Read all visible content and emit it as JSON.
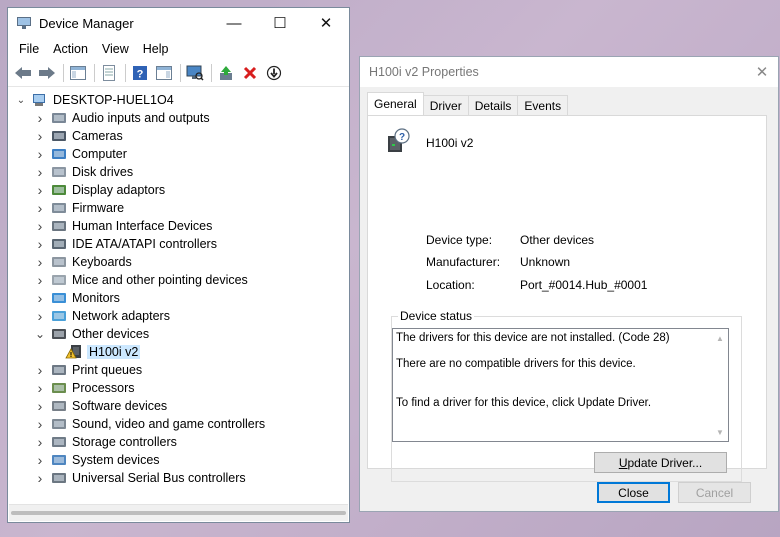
{
  "device_manager": {
    "title": "Device Manager",
    "window_controls": {
      "minimize": "—",
      "maximize": "☐",
      "close": "✕"
    },
    "menu": [
      "File",
      "Action",
      "View",
      "Help"
    ],
    "toolbar_icons": [
      "back-arrow-icon",
      "forward-arrow-icon",
      "show-hide-console-tree-icon",
      "properties-icon",
      "help-icon",
      "action-pane-icon",
      "scan-hardware-icon",
      "update-driver-icon",
      "uninstall-device-icon",
      "disable-device-icon"
    ],
    "tree": {
      "root": "DESKTOP-HUEL1O4",
      "categories": [
        {
          "label": "Audio inputs and outputs",
          "icon": "speaker-icon",
          "expanded": false
        },
        {
          "label": "Cameras",
          "icon": "camera-icon",
          "expanded": false
        },
        {
          "label": "Computer",
          "icon": "computer-icon",
          "expanded": false
        },
        {
          "label": "Disk drives",
          "icon": "disk-drive-icon",
          "expanded": false
        },
        {
          "label": "Display adaptors",
          "icon": "display-adapter-icon",
          "expanded": false
        },
        {
          "label": "Firmware",
          "icon": "firmware-icon",
          "expanded": false
        },
        {
          "label": "Human Interface Devices",
          "icon": "hid-icon",
          "expanded": false
        },
        {
          "label": "IDE ATA/ATAPI controllers",
          "icon": "ide-controller-icon",
          "expanded": false
        },
        {
          "label": "Keyboards",
          "icon": "keyboard-icon",
          "expanded": false
        },
        {
          "label": "Mice and other pointing devices",
          "icon": "mouse-icon",
          "expanded": false
        },
        {
          "label": "Monitors",
          "icon": "monitor-icon",
          "expanded": false
        },
        {
          "label": "Network adapters",
          "icon": "network-adapter-icon",
          "expanded": false
        },
        {
          "label": "Other devices",
          "icon": "unknown-device-icon",
          "expanded": true,
          "children": [
            "H100i v2"
          ]
        },
        {
          "label": "Print queues",
          "icon": "printer-icon",
          "expanded": false
        },
        {
          "label": "Processors",
          "icon": "processor-icon",
          "expanded": false
        },
        {
          "label": "Software devices",
          "icon": "software-device-icon",
          "expanded": false
        },
        {
          "label": "Sound, video and game controllers",
          "icon": "sound-controller-icon",
          "expanded": false
        },
        {
          "label": "Storage controllers",
          "icon": "storage-controller-icon",
          "expanded": false
        },
        {
          "label": "System devices",
          "icon": "system-device-icon",
          "expanded": false
        },
        {
          "label": "Universal Serial Bus controllers",
          "icon": "usb-icon",
          "expanded": false
        }
      ],
      "selected": "H100i v2"
    }
  },
  "properties": {
    "title": "H100i v2 Properties",
    "close_glyph": "✕",
    "tabs": [
      "General",
      "Driver",
      "Details",
      "Events"
    ],
    "active_tab": "General",
    "device_name": "H100i v2",
    "fields": [
      {
        "label": "Device type:",
        "value": "Other devices"
      },
      {
        "label": "Manufacturer:",
        "value": "Unknown"
      },
      {
        "label": "Location:",
        "value": "Port_#0014.Hub_#0001"
      }
    ],
    "device_status": {
      "legend": "Device status",
      "lines": [
        "The drivers for this device are not installed. (Code 28)",
        "There are no compatible drivers for this device.",
        "To find a driver for this device, click Update Driver."
      ]
    },
    "buttons": {
      "update_driver": "Update Driver...",
      "close": "Close",
      "cancel": "Cancel"
    },
    "colors": {
      "accent": "#0078d7",
      "selection": "#cce8ff"
    }
  }
}
